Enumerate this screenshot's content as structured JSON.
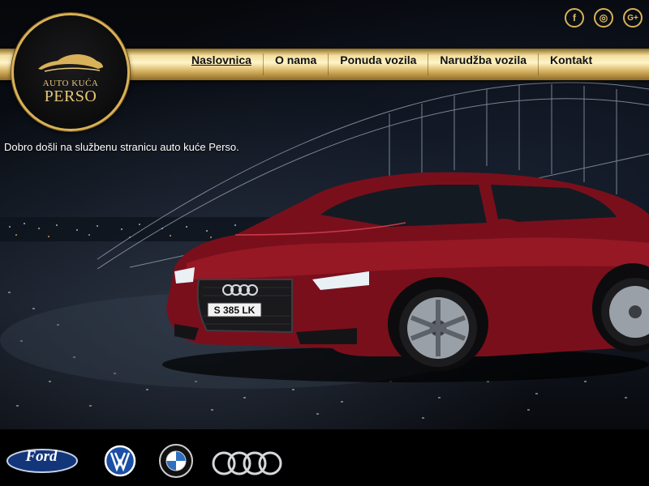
{
  "site": {
    "logo": {
      "line1": "AUTO KUĆA",
      "line2": "PERSO"
    },
    "colors": {
      "gold": "#d9b158",
      "bar_light": "#fff4c8",
      "background": "#000000",
      "car_red": "#7a0f1c"
    }
  },
  "nav": {
    "items": [
      {
        "label": "Naslovnica",
        "active": true
      },
      {
        "label": "O nama",
        "active": false
      },
      {
        "label": "Ponuda vozila",
        "active": false
      },
      {
        "label": "Narudžba vozila",
        "active": false
      },
      {
        "label": "Kontakt",
        "active": false
      }
    ]
  },
  "social": [
    {
      "icon": "facebook-icon",
      "glyph": "f"
    },
    {
      "icon": "instagram-icon",
      "glyph": "◎"
    },
    {
      "icon": "google-plus-icon",
      "glyph": "G+"
    }
  ],
  "hero": {
    "welcome": "Dobro došli na službenu stranicu auto kuće Perso.",
    "car_plate": "S 385 LK"
  },
  "brands": [
    {
      "name": "Ford",
      "icon": "ford-logo"
    },
    {
      "name": "Volkswagen",
      "icon": "volkswagen-logo"
    },
    {
      "name": "BMW",
      "icon": "bmw-logo"
    },
    {
      "name": "Audi",
      "icon": "audi-logo"
    }
  ]
}
